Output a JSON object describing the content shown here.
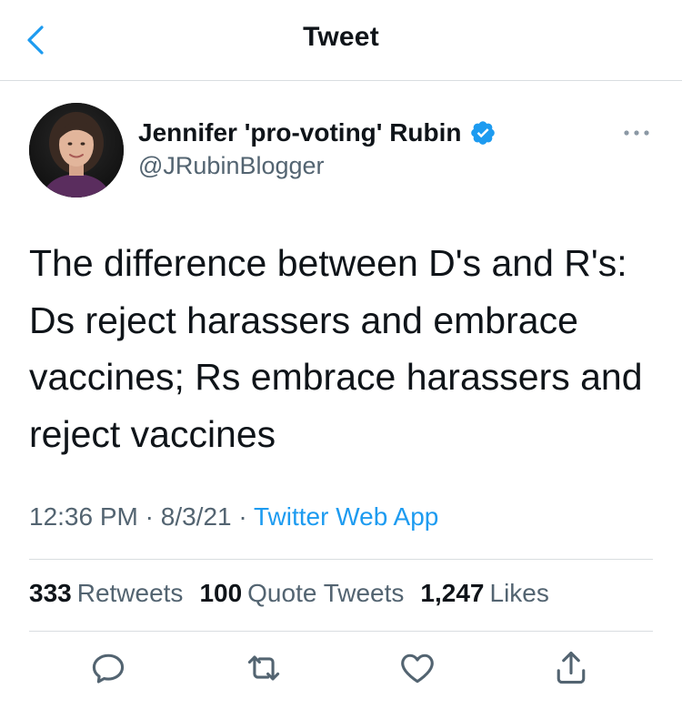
{
  "header": {
    "title": "Tweet",
    "back_icon": "chevron-left-icon"
  },
  "author": {
    "name": "Jennifer 'pro-voting' Rubin",
    "handle": "@JRubinBlogger",
    "verified": true,
    "verified_icon": "verified-badge-icon",
    "more_icon": "more-options-icon"
  },
  "tweet": {
    "text": "The difference between D's and R's:\nDs reject harassers and embrace\nvaccines; Rs embrace harassers and\nreject vaccines"
  },
  "meta": {
    "time": "12:36 PM",
    "separator": " · ",
    "date": "8/3/21",
    "source": "Twitter Web App"
  },
  "stats": {
    "retweets_count": "333",
    "retweets_label": "Retweets",
    "quotes_count": "100",
    "quotes_label": "Quote Tweets",
    "likes_count": "1,247",
    "likes_label": "Likes"
  },
  "actions": [
    {
      "name": "reply",
      "icon": "reply-icon"
    },
    {
      "name": "retweet",
      "icon": "retweet-icon"
    },
    {
      "name": "like",
      "icon": "heart-icon"
    },
    {
      "name": "share",
      "icon": "share-icon"
    }
  ],
  "colors": {
    "accent": "#1d9bf0",
    "text_primary": "#0f1419",
    "text_secondary": "#536471",
    "divider": "#d9dde0",
    "icon": "#536471"
  }
}
